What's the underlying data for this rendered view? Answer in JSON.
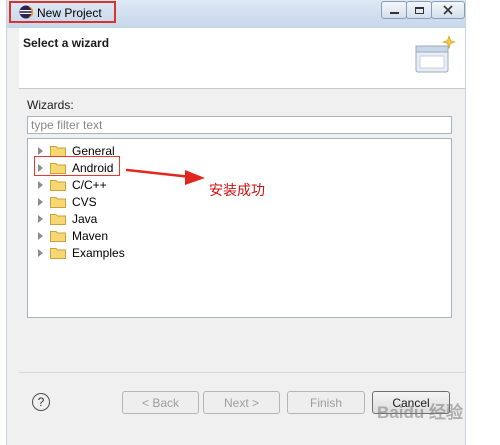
{
  "window": {
    "title": "New Project",
    "minimize_icon": "minimize-icon",
    "maximize_icon": "maximize-icon",
    "close_icon": "close-icon"
  },
  "header": {
    "title": "Select a wizard",
    "banner_icon": "wizard-banner-icon"
  },
  "wizards": {
    "label": "Wizards:",
    "filter_placeholder": "type filter text",
    "filter_value": ""
  },
  "tree": {
    "items": [
      {
        "label": "General",
        "icon": "folder-icon"
      },
      {
        "label": "Android",
        "icon": "folder-icon"
      },
      {
        "label": "C/C++",
        "icon": "folder-icon"
      },
      {
        "label": "CVS",
        "icon": "folder-icon"
      },
      {
        "label": "Java",
        "icon": "folder-icon"
      },
      {
        "label": "Maven",
        "icon": "folder-icon"
      },
      {
        "label": "Examples",
        "icon": "folder-icon"
      }
    ]
  },
  "annotation": {
    "text": "安装成功",
    "color": "#cc1010"
  },
  "footer": {
    "help_label": "?",
    "back_label": "< Back",
    "next_label": "Next >",
    "finish_label": "Finish",
    "cancel_label": "Cancel"
  },
  "watermark": {
    "text": "Baidu 经验"
  },
  "colors": {
    "highlight_red": "#e53a2e",
    "folder_yellow": "#f0c75a"
  }
}
